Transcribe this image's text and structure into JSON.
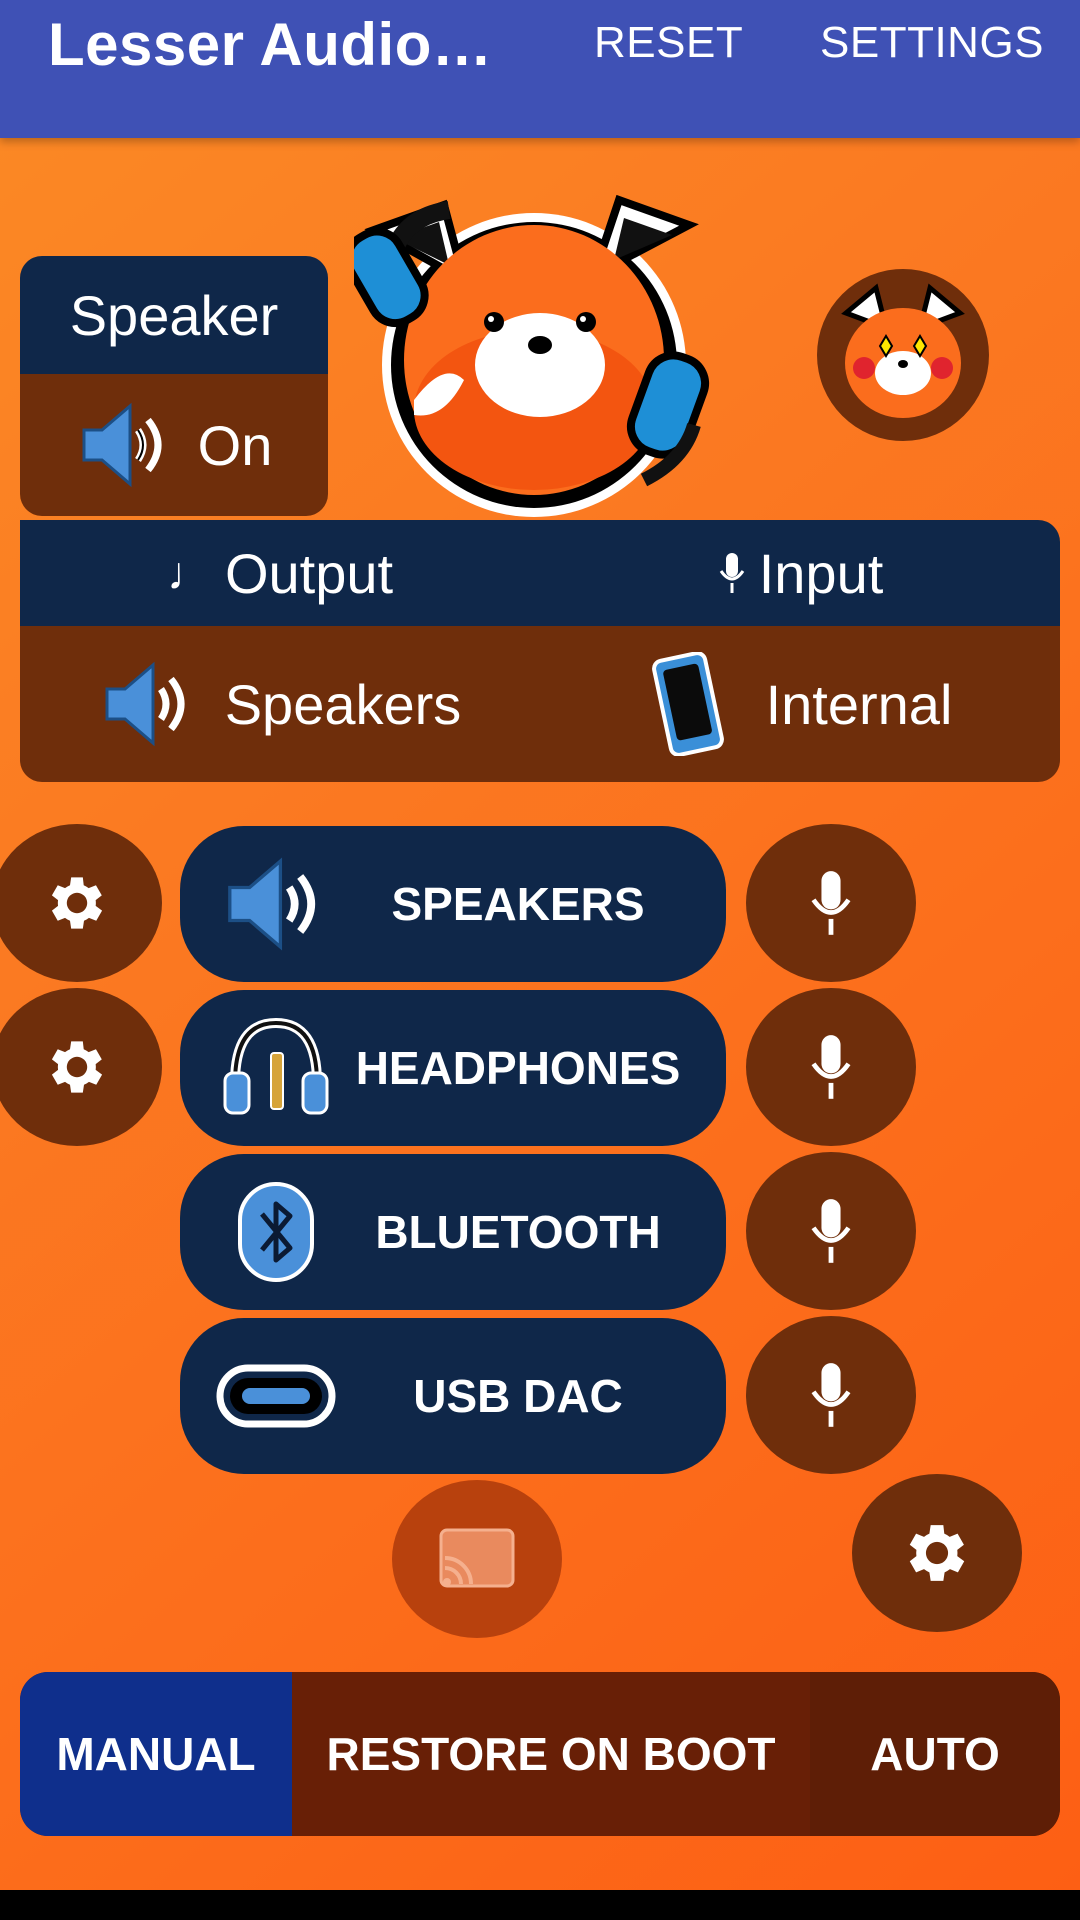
{
  "appbar": {
    "title": "Lesser Audio…",
    "reset_label": "RESET",
    "settings_label": "SETTINGS"
  },
  "status": {
    "title": "Speaker",
    "value": "On",
    "icon": "speaker-icon"
  },
  "io": {
    "output_label": "Output",
    "input_label": "Input",
    "output_value": "Speakers",
    "input_value": "Internal",
    "output_icon": "speaker-icon",
    "input_icon": "phone-icon"
  },
  "devices": [
    {
      "label": "SPEAKERS",
      "icon": "speaker-icon",
      "has_settings": true
    },
    {
      "label": "HEADPHONES",
      "icon": "headphones-icon",
      "has_settings": true
    },
    {
      "label": "BLUETOOTH",
      "icon": "bluetooth-icon",
      "has_settings": false
    },
    {
      "label": "USB DAC",
      "icon": "usb-c-icon",
      "has_settings": false
    }
  ],
  "modes": {
    "manual": "MANUAL",
    "restore": "RESTORE ON BOOT",
    "auto": "AUTO",
    "selected": "MANUAL"
  },
  "colors": {
    "appbar": "#3f51b5",
    "navy": "#0f2749",
    "brown": "#6f2e0b",
    "orange": "#fb7a22",
    "selected_mode": "#0f2f8c"
  }
}
